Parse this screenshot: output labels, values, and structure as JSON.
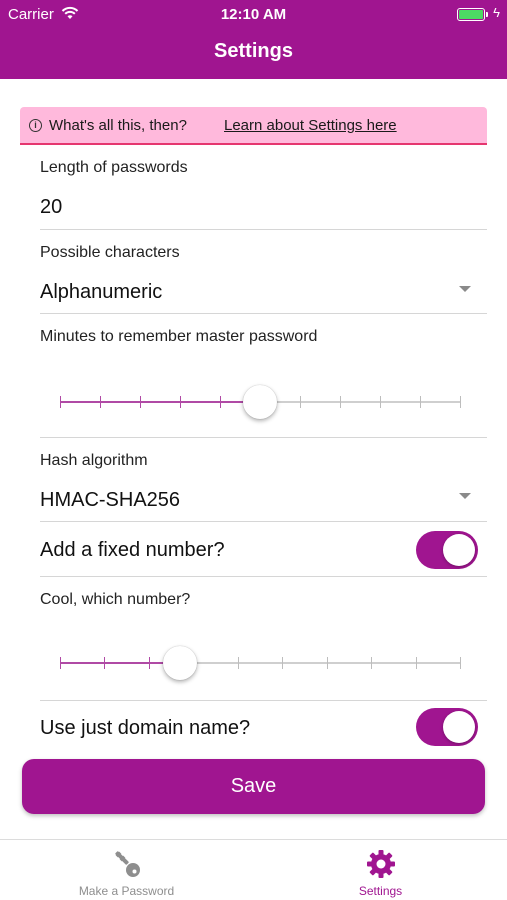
{
  "status_bar": {
    "carrier": "Carrier",
    "time": "12:10 AM"
  },
  "nav": {
    "title": "Settings"
  },
  "info_banner": {
    "text": "What's all this, then?",
    "link": "Learn about Settings here"
  },
  "fields": {
    "length": {
      "label": "Length of passwords",
      "value": "20"
    },
    "characters": {
      "label": "Possible characters",
      "value": "Alphanumeric"
    },
    "minutes": {
      "label": "Minutes to remember master password",
      "level": 0.5
    },
    "hash": {
      "label": "Hash algorithm",
      "value": "HMAC-SHA256"
    },
    "fixed_number": {
      "label": "Add a fixed number?",
      "on": true
    },
    "which_number": {
      "label": "Cool, which number?",
      "level": 0.3
    },
    "domain": {
      "label": "Use just domain name?",
      "on": true
    }
  },
  "save": {
    "label": "Save"
  },
  "tabs": [
    {
      "label": "Make a Password",
      "icon": "key-icon",
      "active": false
    },
    {
      "label": "Settings",
      "icon": "gear-icon",
      "active": true
    }
  ],
  "colors": {
    "accent": "#a01590",
    "banner_bg": "#ffb9dc",
    "banner_border": "#e5366f",
    "battery": "#4cd964"
  }
}
